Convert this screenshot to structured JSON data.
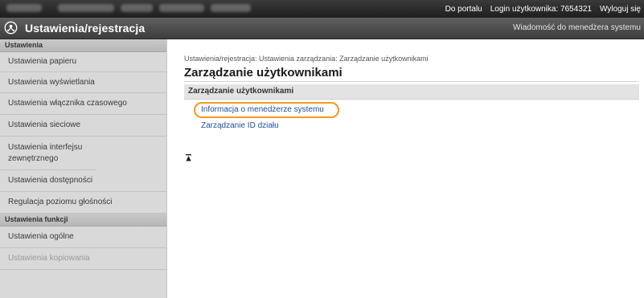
{
  "topbar": {
    "portal_link": "Do portalu",
    "login_label": "Login użytkownika:",
    "login_user": "7654321",
    "logout_link": "Wyloguj się"
  },
  "header": {
    "title": "Ustawienia/rejestracja",
    "message_link": "Wiadomość do menedżera systemu"
  },
  "sidebar": {
    "groups": [
      {
        "label": "Ustawienia",
        "items": [
          "Ustawienia papieru",
          "Ustawienia wyświetlania",
          "Ustawienia włącznika czasowego",
          "Ustawienia sieciowe",
          "Ustawienia interfejsu zewnętrznego",
          "Ustawienia dostępności",
          "Regulacja poziomu głośności"
        ]
      },
      {
        "label": "Ustawienia funkcji",
        "items": [
          "Ustawienia ogólne",
          "Ustawienia kopiowania"
        ]
      }
    ]
  },
  "main": {
    "breadcrumb": "Ustawienia/rejestracja: Ustawienia zarządzania: Zarządzanie użytkownikami",
    "page_title": "Zarządzanie użytkownikami",
    "section_title": "Zarządzanie użytkownikami",
    "links": [
      "Informacja o menedżerze systemu",
      "Zarządzanie ID działu"
    ],
    "highlight_color": "#f39a1c"
  },
  "icons": {
    "logo": "settings-logo-icon",
    "back_to_top": "back-to-top-icon"
  }
}
